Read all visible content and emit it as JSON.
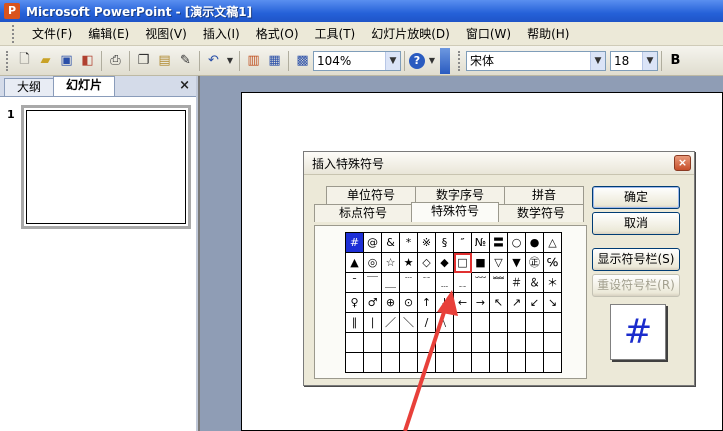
{
  "titlebar": {
    "title": "Microsoft PowerPoint - [演示文稿1]",
    "icon_letter": "P"
  },
  "menu": [
    {
      "label": "文件(F)"
    },
    {
      "label": "编辑(E)"
    },
    {
      "label": "视图(V)"
    },
    {
      "label": "插入(I)"
    },
    {
      "label": "格式(O)"
    },
    {
      "label": "工具(T)"
    },
    {
      "label": "幻灯片放映(D)"
    },
    {
      "label": "窗口(W)"
    },
    {
      "label": "帮助(H)"
    }
  ],
  "toolbar": {
    "zoom": "104%",
    "font_name": "宋体",
    "font_size": "18",
    "bold_label": "B"
  },
  "left_pane": {
    "tabs": [
      {
        "label": "大纲"
      },
      {
        "label": "幻灯片"
      }
    ],
    "close_label": "×",
    "slide_number": "1"
  },
  "dialog": {
    "title": "插入特殊符号",
    "close_label": "×",
    "tabs_back": [
      {
        "label": "单位符号"
      },
      {
        "label": "数字序号"
      },
      {
        "label": "拼音"
      }
    ],
    "tabs_front": [
      {
        "label": "标点符号"
      },
      {
        "label": "特殊符号"
      },
      {
        "label": "数学符号"
      }
    ],
    "buttons": {
      "ok": "确定",
      "cancel": "取消",
      "show_bar": "显示符号栏(S)",
      "reset_bar": "重设符号栏(R)"
    },
    "preview_symbol": "#",
    "grid": [
      [
        "#",
        "@",
        "&",
        "*",
        "※",
        "§",
        "″",
        "№",
        "〓",
        "○",
        "●",
        "△"
      ],
      [
        "▲",
        "◎",
        "☆",
        "★",
        "◇",
        "◆",
        "□",
        "■",
        "▽",
        "▼",
        "㊣",
        "℅"
      ],
      [
        "ˉ",
        "￣",
        "＿",
        "﹉",
        "﹊",
        "﹍",
        "﹎",
        "﹋",
        "﹌",
        "＃",
        "＆",
        "＊"
      ],
      [
        "♀",
        "♂",
        "⊕",
        "⊙",
        "↑",
        "↓",
        "←",
        "→",
        "↖",
        "↗",
        "↙",
        "↘"
      ],
      [
        "∥",
        "∣",
        "／",
        "＼",
        "∕",
        "﹨",
        "",
        "",
        "",
        "",
        "",
        ""
      ],
      [
        "",
        "",
        "",
        "",
        "",
        "",
        "",
        "",
        "",
        "",
        "",
        ""
      ],
      [
        "",
        "",
        "",
        "",
        "",
        "",
        "",
        "",
        "",
        "",
        "",
        ""
      ]
    ],
    "selected_cell": [
      0,
      0
    ],
    "highlighted_cell": [
      1,
      6
    ]
  },
  "colors": {
    "annotation_arrow": "#e8403a",
    "selection": "#1d2fd6"
  }
}
